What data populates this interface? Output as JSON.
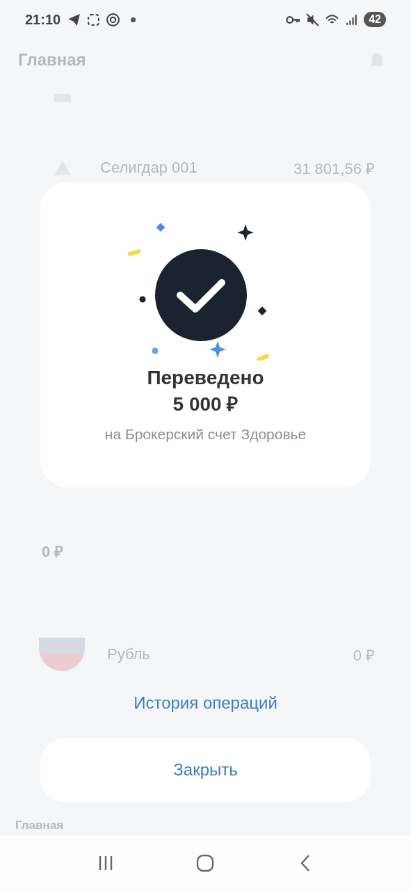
{
  "status_bar": {
    "time": "21:10",
    "battery": "42"
  },
  "background": {
    "title": "Главная",
    "rows": [
      {
        "name": "Селигдар 001",
        "value": "31 801,56 ₽"
      }
    ],
    "balance": "0 ₽",
    "currency": {
      "name": "Рубль",
      "value": "0 ₽"
    },
    "nav_label": "Главная"
  },
  "dialog": {
    "title": "Переведено",
    "amount": "5 000 ₽",
    "subtitle": "на Брокерский счет Здоровье"
  },
  "history_link": "История операций",
  "close_button": "Закрыть"
}
